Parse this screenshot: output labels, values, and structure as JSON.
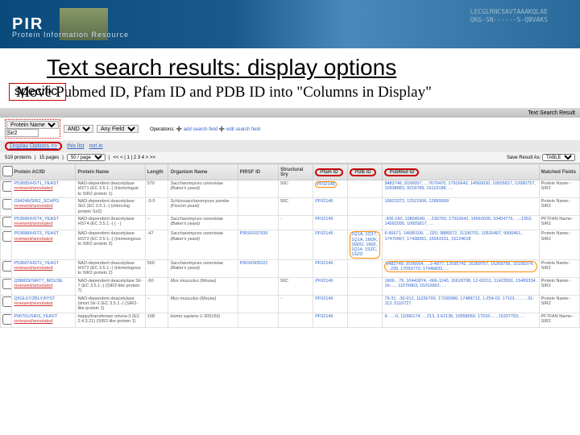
{
  "banner": {
    "logo": "PIR",
    "sub": "Protein Information Resource",
    "seq": "LECGLRNCSAVTAAAKQLAE\nQKG-SN------S-QBVAKS"
  },
  "page": {
    "title": "Text search results: display options",
    "specific": "specific",
    "subtitle": "Move Pubmed ID, Pfam ID and PDB ID into \"Columns in Display\""
  },
  "result_bar": {
    "left": "",
    "right": "Text Search Result"
  },
  "query": {
    "field1": "Protein Name",
    "val1": "Sir2",
    "bool": "AND",
    "field2": "Any Field",
    "ops": "Operations",
    "op1": "add search field",
    "op2": "edit search field"
  },
  "display": {
    "label": "Display Options >>",
    "link1": "this list",
    "link2": "not in"
  },
  "pager": {
    "count": "519 proteins",
    "per": "15 pages",
    "size": "50 / page",
    "nav": "<< < | 1 | 2  3   4   > >>",
    "save": "Save Result As:",
    "fmt": "TABLE"
  },
  "th": {
    "ac": "Protein AC/ID",
    "pn": "Protein Name",
    "len": "Length",
    "org": "Organism Name",
    "pirsf": "PIRSF ID",
    "sto": "Structural Sry",
    "pfam": "Pfam ID",
    "pdb": "PDB ID",
    "pub": "PubMed ID",
    "mf": "Matched Fields"
  },
  "rows": [
    {
      "ac": "P53685/HST1_YEAST",
      "acsub": "reviewed/annotated",
      "pn": "NAD-dependent deacetylase HST1 (EC 3.5.1.-) (Homologue to SIR2 protein 1)",
      "len": "570",
      "org": "Saccharomyces cerevisiae (Baker's yeast)",
      "pirsf": "",
      "sto": "50C",
      "pfam": "PF02146",
      "pdb": "",
      "pub": "9482746, 9106657, …7670470, 17916642, 14560030, 10655817, 12080757, 10938883, 9218789, 16119188, …",
      "mf": "Protein Name:-SIR2"
    },
    {
      "ac": "O94249/SIR2_SCHPO",
      "acsub": "reviewed/annotated",
      "pn": "NAD-dependent deacetylase Sir2 (EC 3.5.1.-) (silencing protein Sir2)",
      "len": "-3-5",
      "org": "Schizosaccharomyces pombe (Fiss/on yeast)",
      "pirsf": "",
      "sto": "50C",
      "pfam": "PF02146",
      "pdb": "",
      "pub": "16823372, 12521906, 12859900",
      "mf": "Protein Name:-SIR2"
    },
    {
      "ac": "P53686/HST4_YEAST",
      "acsub": "reviewed/annotated",
      "pn": "NAD-dependent deacetylase HST4 (EC 3.5.1.-) ( - )",
      "len": "--",
      "org": "Saccharomyces cerevisiae (Baker's yeast)",
      "pirsf": "",
      "sto": "-",
      "pfam": "PF02146",
      "pdb": "",
      "pub": "-306-160, 10894549, …230760, 17916642, 14560030, 10404776, …-1353, 14562095, 10655817, …",
      "mf": "PFTFAN Name:-SIR2"
    },
    {
      "ac": "P53688/HST3_YEAST",
      "acsub": "reviewed/annotated",
      "pn": "NAD-dependent deacetylase HST3 (EC 3.5.1.-) (Homologous to SIR2 protein 3)",
      "len": "-47",
      "org": "Saccharomyces cerevisiae (Baker's yeast)",
      "pirsf": "PIRSF037939",
      "sto": "",
      "pfam": "PF02146",
      "pdb": "1Q1A, 1Q17, 1Q1A, 1M2K, 1M2G, 1M2I, 1Q14, 1SZC, 1SZD",
      "pub": "6-66671, 14685106, …020, 9885572, 11336701, 10526407, 9990461, 17470967, 17438361, 16543151, 15124018",
      "mf": "Protein Name:-SIR2"
    },
    {
      "ac": "P53687/HST2_YEAST",
      "acsub": "reviewed/annotated",
      "pn": "NAD-dependent deacetylase HST2 (EC 3.5.1.-) (Homologous to SIR2 protein 2)",
      "len": "560",
      "org": "Saccharomyces cerevisiae (Baker's yeast)",
      "pirsf": "PIRSF005022",
      "sto": "",
      "pfam": "PF02146",
      "pdb": "",
      "pub": "9482740, 9106664, …2-4877, 12595742, 16269757, 16269756, 15105374, …230, 17093770, 17046832, …",
      "mf": "Protein Name:-SIR2"
    },
    {
      "ac": "Q5B829/SIRT7_MOUSE",
      "acsub": "reviewed/annotated",
      "pn": "NAD-dependent deacetylase Sir-7 (EC 3.5.1.-) (SIR2-like protein 7)",
      "len": "-60",
      "org": "Mus musculus (Mouse)",
      "pirsf": "",
      "sto": "50C",
      "pfam": "PF02146",
      "pdb": "",
      "pub": "1606…76, 10440974, -666-1140, 16618798, 12-60311, 11423591, 15489334, 16-…, 11076863, 15310662, …",
      "mf": "Protein Name:-SIR2"
    },
    {
      "ac": "Q5GL67/ZBLY.RYST",
      "acsub": "reviewed/annotated",
      "pn": "NAD-dependent deacetylase (short Sir-2 (EC 3.5.1.-) (SIR2-like protein 1)",
      "len": "--",
      "org": "Mus musculus (Mouse)",
      "pirsf": "",
      "sto": "-",
      "pfam": "PF02146",
      "pdb": "",
      "pub": "79-31, -30-912, 11336700, 17299086, 17488713, 1-254-02, 17101-…, …31-113, 5110727",
      "mf": "Protein Name:-SIR2"
    },
    {
      "ac": "P06701/SIR3_YEAST",
      "acsub": "reviewed/annotated",
      "pn": "happy/transferase ortuna-3 (EC 2.4.3.21) (SIR2-like protein 1)",
      "len": "198",
      "org": "Homo sapiens 1-305156)",
      "pirsf": "",
      "sto": "",
      "pfam": "PF02146",
      "pdb": "",
      "pub": "6- …-0, 11056174, …213, 3-62136, 10958659, 17016-…, 16337753, …",
      "mf": "PFTFAN Name:-SIR2"
    }
  ]
}
